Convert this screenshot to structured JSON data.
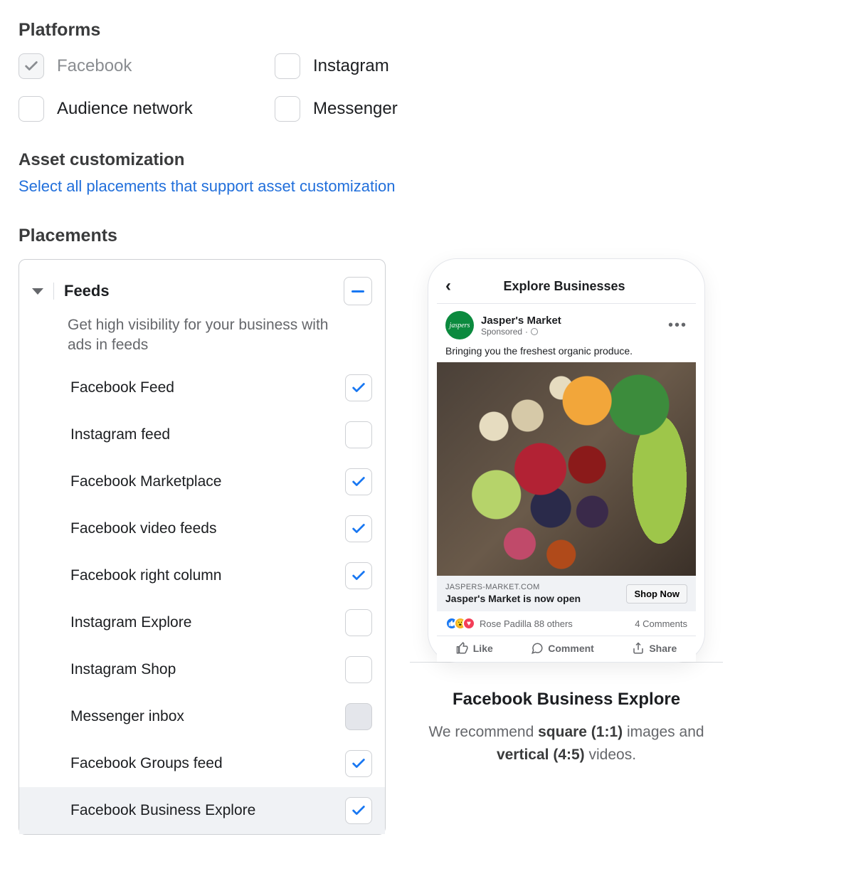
{
  "platforms": {
    "title": "Platforms",
    "items": [
      {
        "label": "Facebook",
        "locked": true,
        "checked": true
      },
      {
        "label": "Instagram",
        "locked": false,
        "checked": false
      },
      {
        "label": "Audience network",
        "locked": false,
        "checked": false
      },
      {
        "label": "Messenger",
        "locked": false,
        "checked": false
      }
    ]
  },
  "asset": {
    "title": "Asset customization",
    "link": "Select all placements that support asset customization"
  },
  "placements": {
    "title": "Placements",
    "group_title": "Feeds",
    "group_desc": "Get high visibility for your business with ads in feeds",
    "items": [
      {
        "label": "Facebook Feed",
        "checked": true,
        "disabled": false,
        "selected": false
      },
      {
        "label": "Instagram feed",
        "checked": false,
        "disabled": false,
        "selected": false
      },
      {
        "label": "Facebook Marketplace",
        "checked": true,
        "disabled": false,
        "selected": false
      },
      {
        "label": "Facebook video feeds",
        "checked": true,
        "disabled": false,
        "selected": false
      },
      {
        "label": "Facebook right column",
        "checked": true,
        "disabled": false,
        "selected": false
      },
      {
        "label": "Instagram Explore",
        "checked": false,
        "disabled": false,
        "selected": false
      },
      {
        "label": "Instagram Shop",
        "checked": false,
        "disabled": false,
        "selected": false
      },
      {
        "label": "Messenger inbox",
        "checked": false,
        "disabled": true,
        "selected": false
      },
      {
        "label": "Facebook Groups feed",
        "checked": true,
        "disabled": false,
        "selected": false
      },
      {
        "label": "Facebook Business Explore",
        "checked": true,
        "disabled": false,
        "selected": true
      }
    ]
  },
  "preview": {
    "topbar_title": "Explore Businesses",
    "brand": "Jasper's Market",
    "sponsored": "Sponsored",
    "caption": "Bringing you the freshest organic produce.",
    "link_domain": "JASPERS-MARKET.COM",
    "link_headline": "Jasper's Market is now open",
    "cta": "Shop Now",
    "reactions_text": "Rose Padilla 88 others",
    "comments": "4 Comments",
    "like": "Like",
    "comment": "Comment",
    "share": "Share",
    "title": "Facebook Business Explore",
    "rec_pre": "We recommend ",
    "rec_sq": "square (1:1)",
    "rec_mid": " images and ",
    "rec_vert": "vertical (4:5)",
    "rec_post": " videos."
  }
}
